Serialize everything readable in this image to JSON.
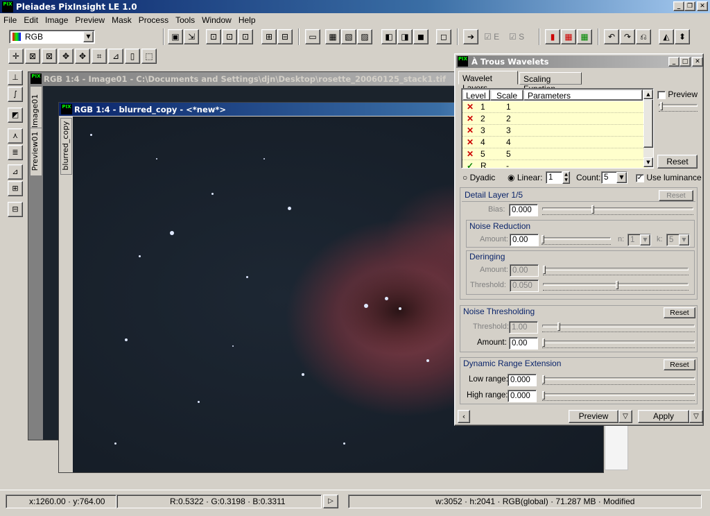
{
  "app": {
    "title": "Pleiades PixInsight LE 1.0",
    "icon_label": "PIX"
  },
  "window_controls": [
    "_",
    "❐",
    "✕"
  ],
  "menu": [
    "File",
    "Edit",
    "Image",
    "Preview",
    "Mask",
    "Process",
    "Tools",
    "Window",
    "Help"
  ],
  "toolbar": {
    "color_space": "RGB",
    "toggle_e": "E",
    "toggle_s": "S"
  },
  "image_windows": {
    "back": {
      "title": "RGB 1:4 - Image01 - C:\\Documents and Settings\\djn\\Desktop\\rosette_20060125_stack1.tif",
      "tab_main": "Image01",
      "tab_preview": "Preview01"
    },
    "front": {
      "title": "RGB 1:4 - blurred_copy - <*new*>",
      "tab_main": "blurred_copy"
    }
  },
  "wavelets": {
    "title": "À Trous Wavelets",
    "tabs": [
      "Wavelet Layers",
      "Scaling Function"
    ],
    "table_headers": [
      "Level",
      "Scale",
      "Parameters"
    ],
    "rows": [
      {
        "mark": "✕",
        "level": "1",
        "scale": "1"
      },
      {
        "mark": "✕",
        "level": "2",
        "scale": "2"
      },
      {
        "mark": "✕",
        "level": "3",
        "scale": "3"
      },
      {
        "mark": "✕",
        "level": "4",
        "scale": "4"
      },
      {
        "mark": "✕",
        "level": "5",
        "scale": "5"
      },
      {
        "mark": "✓",
        "level": "R",
        "scale": "-"
      }
    ],
    "preview_label": "Preview",
    "reset_label": "Reset",
    "dyadic_label": "Dyadic",
    "linear_label": "Linear:",
    "linear_value": "1",
    "count_label": "Count:",
    "count_value": "5",
    "use_luminance_label": "Use luminance",
    "detail_layer": {
      "header": "Detail Layer 1/5",
      "reset": "Reset",
      "bias_label": "Bias:",
      "bias_value": "0.000",
      "noise_reduction": {
        "header": "Noise Reduction",
        "amount_label": "Amount:",
        "amount_value": "0.00",
        "n_label": "n:",
        "n_value": "1",
        "k_label": "k:",
        "k_value": "5"
      },
      "deringing": {
        "header": "Deringing",
        "amount_label": "Amount:",
        "amount_value": "0.00",
        "threshold_label": "Threshold:",
        "threshold_value": "0.050"
      }
    },
    "noise_thresholding": {
      "header": "Noise Thresholding",
      "reset": "Reset",
      "threshold_label": "Threshold:",
      "threshold_value": "1.00",
      "amount_label": "Amount:",
      "amount_value": "0.00"
    },
    "dre": {
      "header": "Dynamic Range Extension",
      "reset": "Reset",
      "low_label": "Low range:",
      "low_value": "0.000",
      "high_label": "High range:",
      "high_value": "0.000"
    },
    "preview_button": "Preview",
    "apply_button": "Apply"
  },
  "status": {
    "coords": "x:1260.00 · y:764.00",
    "rgb": "R:0.5322 · G:0.3198 · B:0.3311",
    "info": "w:3052 · h:2041 · RGB(global) · 71.287 MB · Modified"
  }
}
